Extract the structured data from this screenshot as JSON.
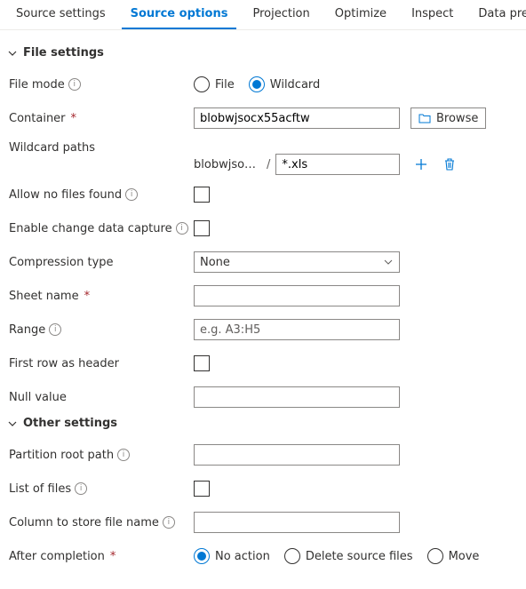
{
  "tabs": {
    "source_settings": "Source settings",
    "source_options": "Source options",
    "projection": "Projection",
    "optimize": "Optimize",
    "inspect": "Inspect",
    "data_preview": "Data preview"
  },
  "sections": {
    "file_settings": "File settings",
    "other_settings": "Other settings"
  },
  "labels": {
    "file_mode": "File mode",
    "container": "Container",
    "wildcard_paths": "Wildcard paths",
    "allow_no_files": "Allow no files found",
    "enable_cdc": "Enable change data capture",
    "compression_type": "Compression type",
    "sheet_name": "Sheet name",
    "range": "Range",
    "first_row_header": "First row as header",
    "null_value": "Null value",
    "partition_root": "Partition root path",
    "list_of_files": "List of files",
    "column_file_name": "Column to store file name",
    "after_completion": "After completion"
  },
  "file_mode": {
    "file": "File",
    "wildcard": "Wildcard"
  },
  "container": {
    "value": "blobwjsocx55acftw",
    "browse": "Browse"
  },
  "wildcard": {
    "prefix": "blobwjsoc...",
    "value": "*.xls"
  },
  "compression": {
    "value": "None"
  },
  "range_placeholder": "e.g. A3:H5",
  "after_completion": {
    "no_action": "No action",
    "delete": "Delete source files",
    "move": "Move"
  }
}
